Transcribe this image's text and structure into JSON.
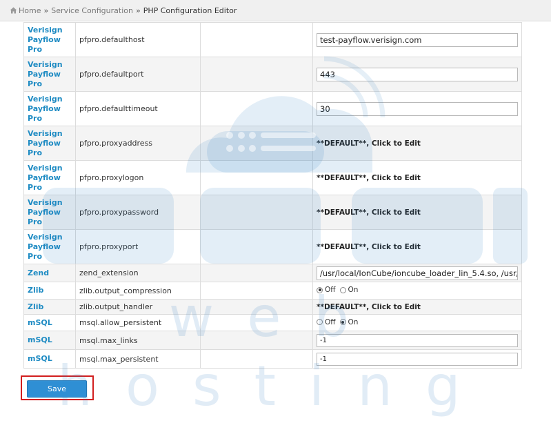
{
  "breadcrumb": {
    "home": "Home",
    "separator": "»",
    "section": "Service Configuration",
    "current": "PHP Configuration Editor"
  },
  "rows": [
    {
      "section": [
        "Verisign",
        "Payflow",
        "Pro"
      ],
      "directive": "pfpro.defaulthost",
      "type": "text",
      "value": "test-payflow.verisign.com"
    },
    {
      "section": [
        "Verisign",
        "Payflow",
        "Pro"
      ],
      "directive": "pfpro.defaultport",
      "type": "text",
      "value": "443"
    },
    {
      "section": [
        "Verisign",
        "Payflow",
        "Pro"
      ],
      "directive": "pfpro.defaulttimeout",
      "type": "text",
      "value": "30"
    },
    {
      "section": [
        "Verisign",
        "Payflow",
        "Pro"
      ],
      "directive": "pfpro.proxyaddress",
      "type": "default",
      "value": "**DEFAULT**, Click to Edit"
    },
    {
      "section": [
        "Verisign",
        "Payflow",
        "Pro"
      ],
      "directive": "pfpro.proxylogon",
      "type": "default",
      "value": "**DEFAULT**, Click to Edit"
    },
    {
      "section": [
        "Verisign",
        "Payflow",
        "Pro"
      ],
      "directive": "pfpro.proxypassword",
      "type": "default",
      "value": "**DEFAULT**, Click to Edit"
    },
    {
      "section": [
        "Verisign",
        "Payflow",
        "Pro"
      ],
      "directive": "pfpro.proxyport",
      "type": "default",
      "value": "**DEFAULT**, Click to Edit"
    },
    {
      "section": [
        "Zend"
      ],
      "directive": "zend_extension",
      "type": "text",
      "value": "/usr/local/IonCube/ioncube_loader_lin_5.4.so, /usr/lo"
    },
    {
      "section": [
        "Zlib"
      ],
      "directive": "zlib.output_compression",
      "type": "radio",
      "options": [
        "Off",
        "On"
      ],
      "selected": "Off"
    },
    {
      "section": [
        "Zlib"
      ],
      "directive": "zlib.output_handler",
      "type": "default",
      "value": "**DEFAULT**, Click to Edit"
    },
    {
      "section": [
        "mSQL"
      ],
      "directive": "msql.allow_persistent",
      "type": "radio",
      "options": [
        "Off",
        "On"
      ],
      "selected": "On"
    },
    {
      "section": [
        "mSQL"
      ],
      "directive": "msql.max_links",
      "type": "text-small",
      "value": "-1"
    },
    {
      "section": [
        "mSQL"
      ],
      "directive": "msql.max_persistent",
      "type": "text-small",
      "value": "-1"
    }
  ],
  "save_label": "Save",
  "watermark": "web hosting",
  "colors": {
    "accent": "#1e8bc3",
    "button": "#2f8fd4",
    "highlight": "#d21e1e"
  },
  "icons": {
    "home": "home-icon"
  }
}
